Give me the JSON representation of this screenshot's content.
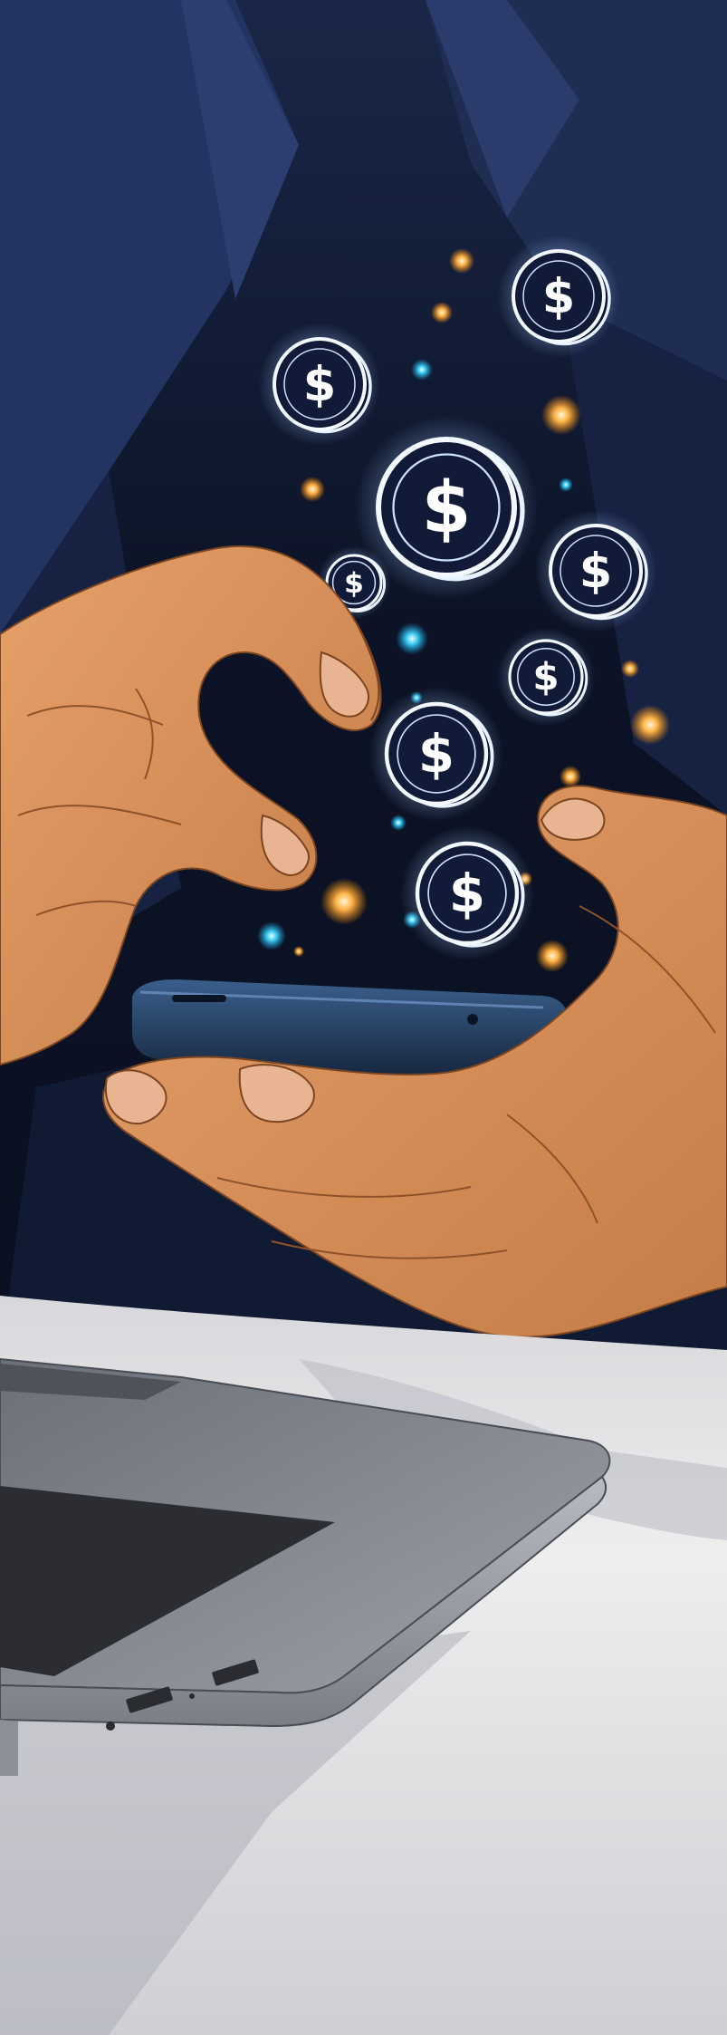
{
  "illustration": {
    "coin_symbol": "$",
    "colors": {
      "background_dark": "#0c1326",
      "shirt_blue": "#1b2847",
      "skin": "#d9925a",
      "skin_shadow": "#a8653a",
      "coin_glow": "#e8f1ff",
      "spark_orange": "#ffa63a",
      "spark_cyan": "#36c9ef",
      "phone": "#1d3557",
      "desk": "#e6e4e6",
      "laptop": "#7d8189",
      "keys": "#1d1e23"
    }
  }
}
